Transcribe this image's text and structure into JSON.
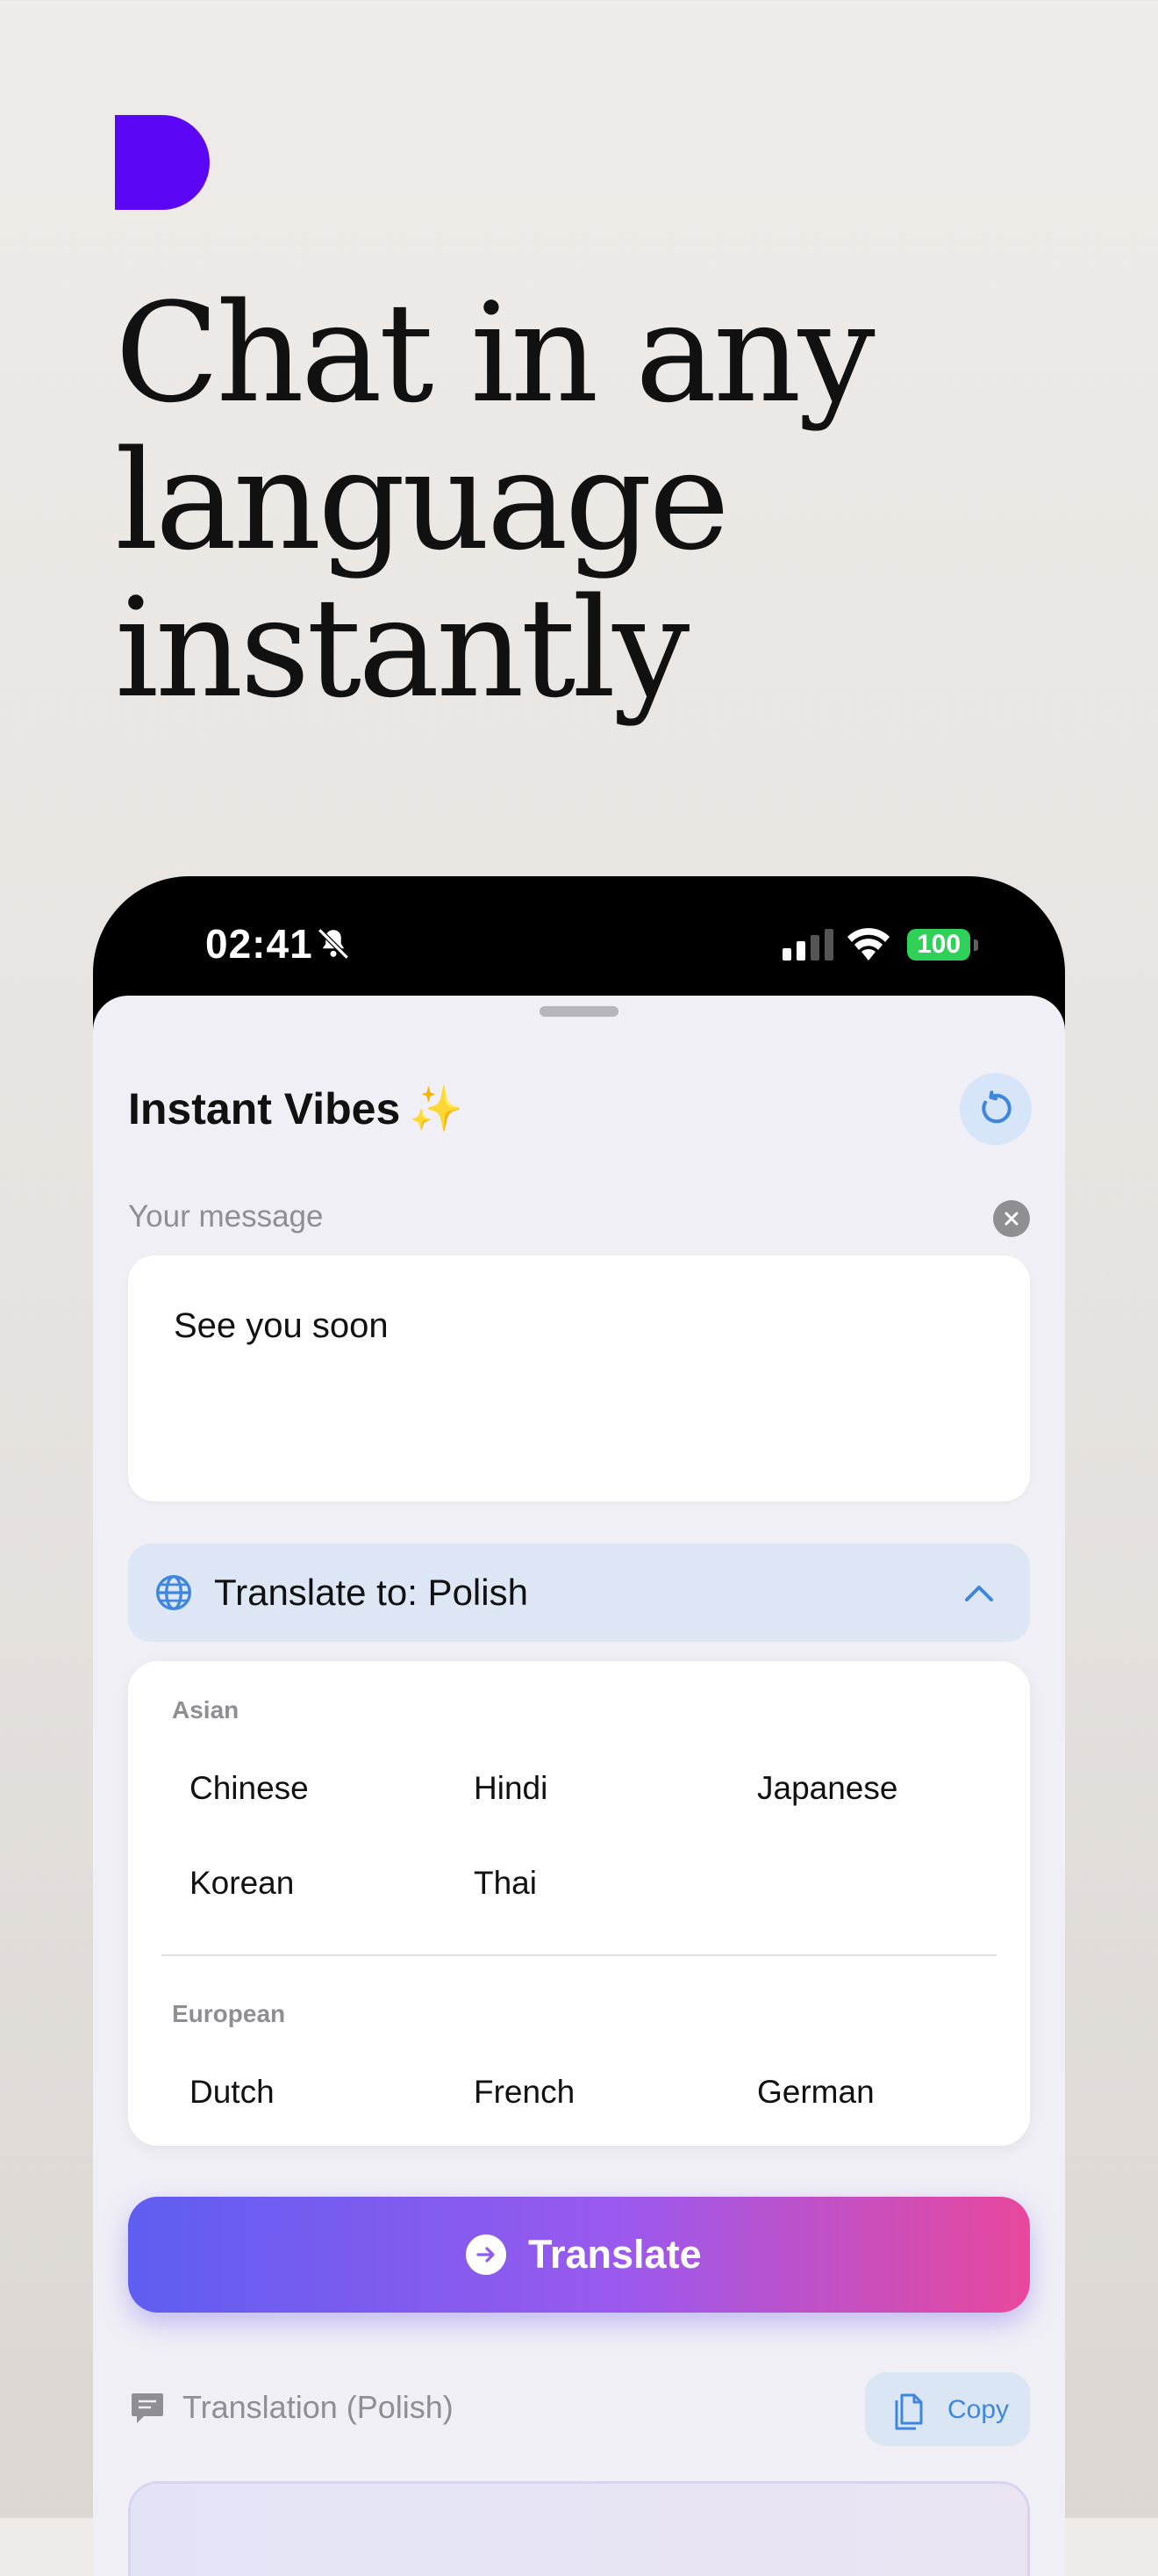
{
  "hero": {
    "headline_lines": [
      "Chat in any",
      "language",
      "instantly"
    ]
  },
  "status_bar": {
    "time": "02:41",
    "battery": "100"
  },
  "app": {
    "title": "Instant Vibes",
    "title_emoji": "✨",
    "message_label": "Your message",
    "message_value": "See you soon",
    "translate_to_label": "Translate to: Polish",
    "language_groups": [
      {
        "name": "Asian",
        "languages": [
          "Chinese",
          "Hindi",
          "Japanese",
          "Korean",
          "Thai"
        ]
      },
      {
        "name": "European",
        "languages": [
          "Dutch",
          "French",
          "German"
        ]
      }
    ],
    "translate_button": "Translate",
    "output_label": "Translation (Polish)",
    "copy_button": "Copy"
  },
  "colors": {
    "logo": "#5b07f5",
    "accent_blue": "#3f86de",
    "button_gradient": [
      "#5e5ef0",
      "#9b59ee",
      "#e8489c"
    ],
    "battery_green": "#30d158"
  },
  "icons": [
    "logo-mark",
    "bell-slash-icon",
    "signal-icon",
    "wifi-icon",
    "reset-icon",
    "clear-icon",
    "globe-icon",
    "chevron-up-icon",
    "arrow-right-circle-icon",
    "chat-bubble-icon",
    "copy-icon"
  ]
}
